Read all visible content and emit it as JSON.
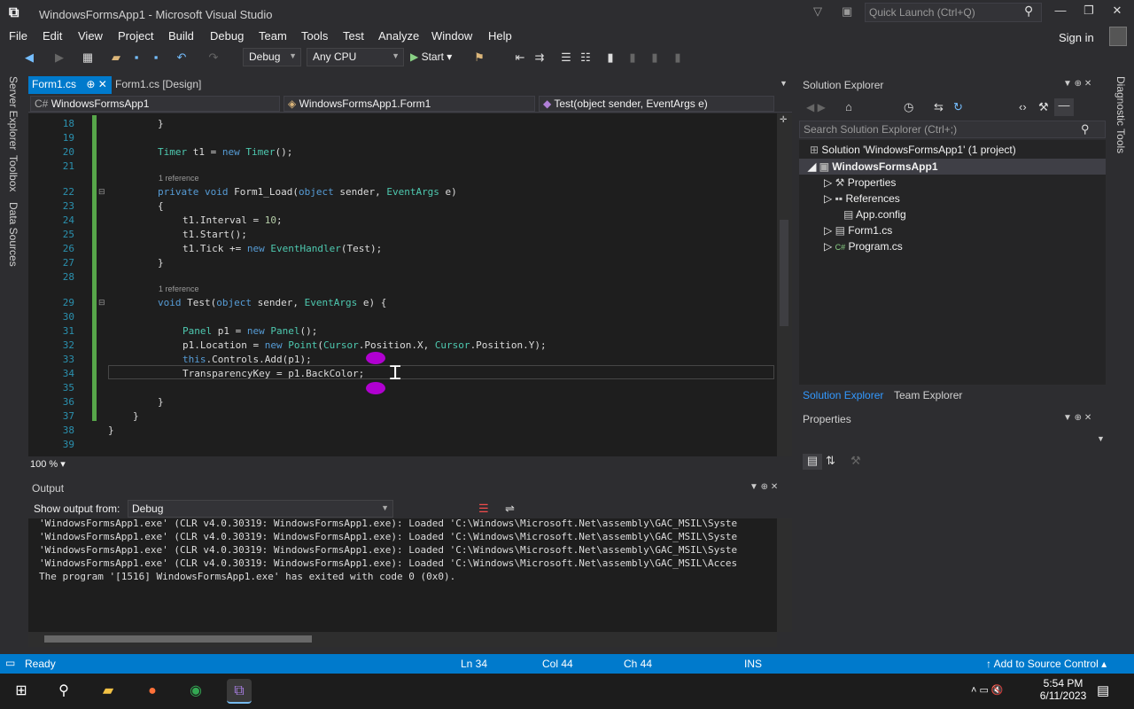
{
  "window": {
    "title": "WindowsFormsApp1 - Microsoft Visual Studio",
    "quick_launch": "Quick Launch (Ctrl+Q)",
    "sign_in": "Sign in"
  },
  "menu": [
    "File",
    "Edit",
    "View",
    "Project",
    "Build",
    "Debug",
    "Team",
    "Tools",
    "Test",
    "Analyze",
    "Window",
    "Help"
  ],
  "toolbar": {
    "config": "Debug",
    "platform": "Any CPU",
    "start": "Start"
  },
  "left_tabs": [
    "Server Explorer",
    "Toolbox",
    "Data Sources"
  ],
  "right_tabs": [
    "Diagnostic Tools"
  ],
  "doc_tabs": {
    "active": "Form1.cs",
    "other": "Form1.cs [Design]"
  },
  "nav": {
    "project": "WindowsFormsApp1",
    "class": "WindowsFormsApp1.Form1",
    "member": "Test(object sender, EventArgs e)"
  },
  "editor": {
    "lines": [
      "18",
      "19",
      "20",
      "21",
      "",
      "22",
      "23",
      "24",
      "25",
      "26",
      "27",
      "28",
      "",
      "29",
      "30",
      "31",
      "32",
      "33",
      "34",
      "35",
      "36",
      "37",
      "38",
      "39"
    ],
    "refs": [
      "1 reference",
      "1 reference"
    ],
    "zoom": "100 %"
  },
  "output": {
    "title": "Output",
    "show_from_label": "Show output from:",
    "source": "Debug",
    "lines": [
      "'WindowsFormsApp1.exe' (CLR v4.0.30319: WindowsFormsApp1.exe): Loaded 'C:\\Windows\\Microsoft.Net\\assembly\\GAC_MSIL\\Syste",
      "'WindowsFormsApp1.exe' (CLR v4.0.30319: WindowsFormsApp1.exe): Loaded 'C:\\Windows\\Microsoft.Net\\assembly\\GAC_MSIL\\Syste",
      "'WindowsFormsApp1.exe' (CLR v4.0.30319: WindowsFormsApp1.exe): Loaded 'C:\\Windows\\Microsoft.Net\\assembly\\GAC_MSIL\\Syste",
      "'WindowsFormsApp1.exe' (CLR v4.0.30319: WindowsFormsApp1.exe): Loaded 'C:\\Windows\\Microsoft.Net\\assembly\\GAC_MSIL\\Acces",
      "The program '[1516] WindowsFormsApp1.exe' has exited with code 0 (0x0)."
    ]
  },
  "solution_explorer": {
    "title": "Solution Explorer",
    "search": "Search Solution Explorer (Ctrl+;)",
    "solution": "Solution 'WindowsFormsApp1' (1 project)",
    "project": "WindowsFormsApp1",
    "items": [
      "Properties",
      "References",
      "App.config",
      "Form1.cs",
      "Program.cs"
    ],
    "tab_active": "Solution Explorer",
    "tab_other": "Team Explorer"
  },
  "properties": {
    "title": "Properties"
  },
  "status": {
    "ready": "Ready",
    "ln": "Ln 34",
    "col": "Col 44",
    "ch": "Ch 44",
    "ins": "INS",
    "source_control": "Add to Source Control"
  },
  "clock": {
    "time": "5:54 PM",
    "date": "6/11/2023"
  }
}
